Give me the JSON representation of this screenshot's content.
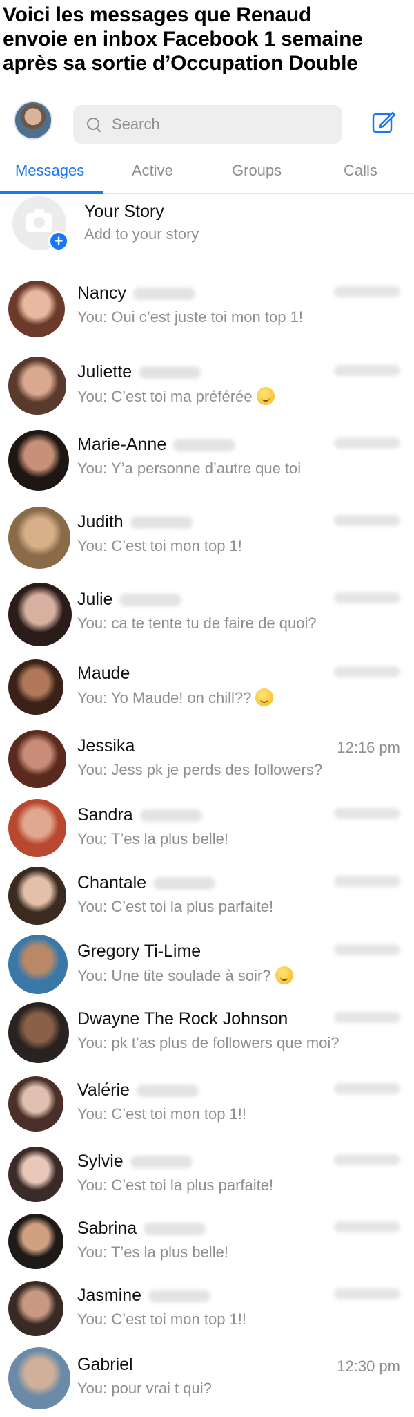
{
  "headline": {
    "line1": "Voici les messages que Renaud",
    "line2": "envoie en inbox Facebook 1 semaine",
    "line3": "après sa sortie d’Occupation Double"
  },
  "search": {
    "placeholder": "Search"
  },
  "icons": {
    "search": "search-icon",
    "compose": "compose-icon",
    "camera": "camera-icon",
    "add": "plus-icon"
  },
  "colors": {
    "accent": "#1877f2",
    "muted": "#8e8e93",
    "search_bg": "#eeeeef"
  },
  "tabs": [
    {
      "label": "Messages",
      "active": true
    },
    {
      "label": "Active",
      "active": false
    },
    {
      "label": "Groups",
      "active": false
    },
    {
      "label": "Calls",
      "active": false
    }
  ],
  "story": {
    "title": "Your Story",
    "subtitle": "Add to your story"
  },
  "conversations": [
    {
      "name": "Nancy",
      "message": "You: Oui c’est juste toi mon top 1!",
      "time": "",
      "surname_blurred": true
    },
    {
      "name": "Juliette",
      "message": "You: C’est toi ma préférée",
      "time": "",
      "surname_blurred": true,
      "emoji": "slight-smile-emoji"
    },
    {
      "name": "Marie-Anne",
      "message": "You: Y’a personne d’autre que toi",
      "time": "",
      "surname_blurred": true
    },
    {
      "name": "Judith",
      "message": "You: C’est toi mon top 1!",
      "time": "",
      "surname_blurred": true
    },
    {
      "name": "Julie",
      "message": "You: ca te tente tu de faire de quoi?",
      "time": "",
      "surname_blurred": true
    },
    {
      "name": "Maude",
      "message": "You: Yo Maude! on chill??",
      "time": "",
      "surname_blurred": false,
      "emoji": "wink-emoji"
    },
    {
      "name": "Jessika",
      "message": "You: Jess pk je perds des followers?",
      "time": "12:16 pm",
      "surname_blurred": false
    },
    {
      "name": "Sandra",
      "message": "You: T’es la plus belle!",
      "time": "",
      "surname_blurred": true
    },
    {
      "name": "Chantale",
      "message": "You: C’est toi la plus parfaite!",
      "time": "",
      "surname_blurred": true
    },
    {
      "name": "Gregory Ti-Lime",
      "message": "You: Une tite soulade à soir?",
      "time": "",
      "surname_blurred": false,
      "emoji": "tongue-emoji"
    },
    {
      "name": "Dwayne The Rock Johnson",
      "message": "You: pk t’as plus de followers que moi?",
      "time": "",
      "surname_blurred": false
    },
    {
      "name": "Valérie",
      "message": "You: C’est toi mon top 1!!",
      "time": "",
      "surname_blurred": true
    },
    {
      "name": "Sylvie",
      "message": "You: C’est toi la plus parfaite!",
      "time": "",
      "surname_blurred": true
    },
    {
      "name": "Sabrina",
      "message": "You: T’es la plus belle!",
      "time": "",
      "surname_blurred": true
    },
    {
      "name": "Jasmine",
      "message": "You: C’est toi mon top 1!!",
      "time": "",
      "surname_blurred": true
    },
    {
      "name": "Gabriel",
      "message": "You: pour vrai t qui?",
      "time": "12:30 pm",
      "surname_blurred": false
    }
  ]
}
